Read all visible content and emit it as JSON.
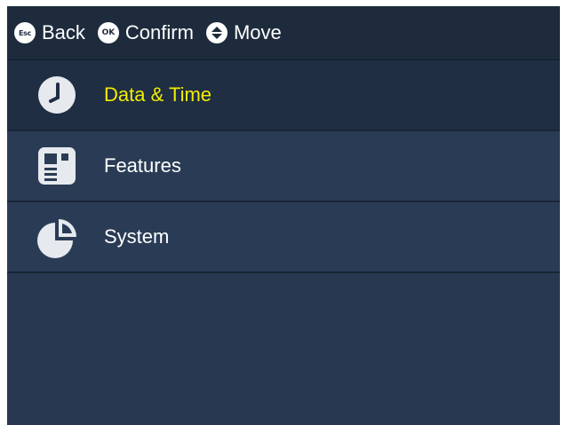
{
  "topbar": {
    "hints": [
      {
        "key": "Esc",
        "label": "Back",
        "icon": "esc-key-icon"
      },
      {
        "key": "OK",
        "label": "Confirm",
        "icon": "ok-key-icon"
      },
      {
        "key": "",
        "label": "Move",
        "icon": "up-down-arrows-icon"
      }
    ]
  },
  "menu": {
    "items": [
      {
        "label": "Data & Time",
        "icon": "clock-icon",
        "selected": true
      },
      {
        "label": "Features",
        "icon": "features-icon",
        "selected": false
      },
      {
        "label": "System",
        "icon": "pie-chart-icon",
        "selected": false
      }
    ]
  },
  "colors": {
    "background": "#283850",
    "topbar": "#1d2b3d",
    "selected_text": "#f2ec00",
    "text": "#ffffff"
  }
}
